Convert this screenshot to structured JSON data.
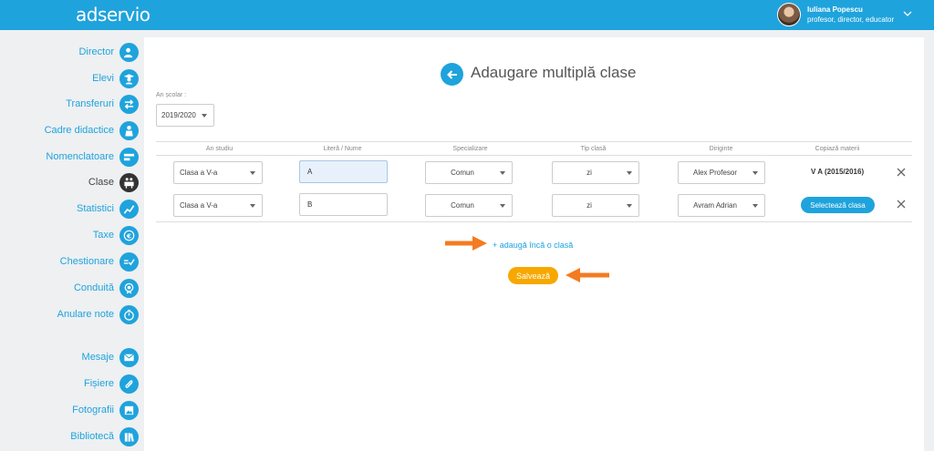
{
  "app": {
    "logo_text": "adservio"
  },
  "user": {
    "name": "Iuliana Popescu",
    "roles": "profesor, director, educator"
  },
  "sidebar": {
    "items": [
      {
        "label": "Director",
        "icon": "user-tie-icon"
      },
      {
        "label": "Elevi",
        "icon": "graduate-icon"
      },
      {
        "label": "Transferuri",
        "icon": "transfer-arrows-icon"
      },
      {
        "label": "Cadre didactice",
        "icon": "teacher-icon"
      },
      {
        "label": "Nomenclatoare",
        "icon": "card-icon"
      },
      {
        "label": "Clase",
        "icon": "classroom-icon",
        "active": true
      },
      {
        "label": "Statistici",
        "icon": "chart-line-icon"
      },
      {
        "label": "Taxe",
        "icon": "euro-icon"
      },
      {
        "label": "Chestionare",
        "icon": "checklist-icon"
      },
      {
        "label": "Conduită",
        "icon": "medal-icon"
      },
      {
        "label": "Anulare note",
        "icon": "timer-icon"
      },
      {
        "label": "Mesaje",
        "icon": "envelope-icon"
      },
      {
        "label": "Fișiere",
        "icon": "paperclip-icon"
      },
      {
        "label": "Fotografii",
        "icon": "photo-icon"
      },
      {
        "label": "Bibliotecă",
        "icon": "books-icon"
      }
    ]
  },
  "page": {
    "title": "Adaugare multiplă clase",
    "year_label": "An școlar :",
    "year_value": "2019/2020"
  },
  "table": {
    "headers": [
      "An studiu",
      "Literă / Nume",
      "Specializare",
      "Tip clasă",
      "Diriginte",
      "Copiază materii"
    ],
    "rows": [
      {
        "an_studiu": "Clasa a V-a",
        "litera": "A",
        "specializare": "Comun",
        "tip": "zi",
        "diriginte": "Alex Profesor",
        "copy_text": "V A (2015/2016)"
      },
      {
        "an_studiu": "Clasa a V-a",
        "litera": "B",
        "specializare": "Comun",
        "tip": "zi",
        "diriginte": "Avram Adrian",
        "copy_button": "Selectează clasa"
      }
    ]
  },
  "actions": {
    "add_link": "+ adaugă încă o clasă",
    "save_label": "Salvează"
  },
  "colors": {
    "accent": "#1fa3dc",
    "save": "#f7a800",
    "annotation_arrow": "#f47b20"
  }
}
